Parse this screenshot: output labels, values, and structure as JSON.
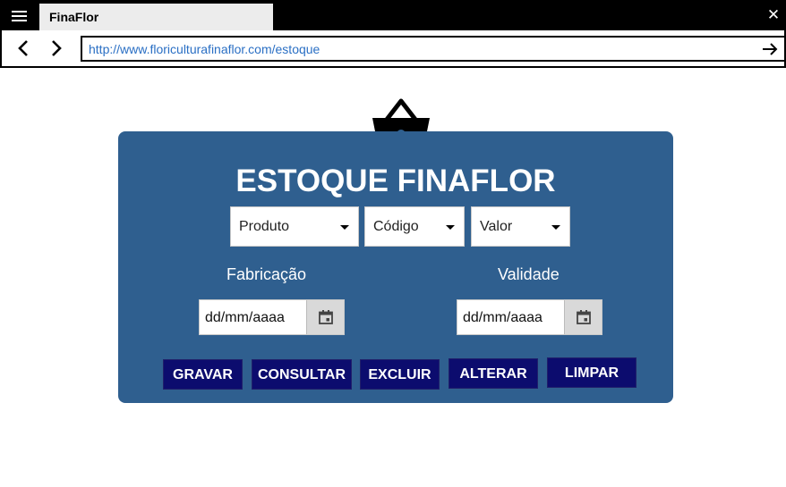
{
  "browser": {
    "tab_title": "FinaFlor",
    "url": "http://www.floriculturafinaflor.com/estoque",
    "icons": {
      "menu": "hamburger-menu-icon",
      "close": "close-icon",
      "back": "back-arrow-icon",
      "forward": "forward-arrow-icon",
      "go": "go-arrow-icon"
    }
  },
  "page": {
    "logo_icon": "basket-icon",
    "title": "ESTOQUE FINAFLOR",
    "selects": {
      "produto": "Produto",
      "codigo": "Código",
      "valor": "Valor"
    },
    "labels": {
      "fabricacao": "Fabricação",
      "validade": "Validade"
    },
    "date_fields": {
      "fabricacao_placeholder": "dd/mm/aaaa",
      "validade_placeholder": "dd/mm/aaaa"
    },
    "buttons": {
      "gravar": "GRAVAR",
      "consultar": "CONSULTAR",
      "excluir": "EXCLUIR",
      "alterar": "ALTERAR",
      "limpar": "LIMPAR"
    },
    "colors": {
      "panel": "#2f5f8f",
      "button": "#0c0c6e",
      "url_text": "#2a6fc4"
    }
  }
}
